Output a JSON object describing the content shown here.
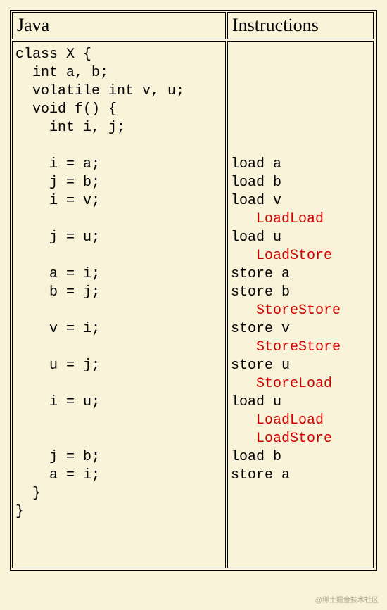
{
  "headers": {
    "left": "Java",
    "right": "Instructions"
  },
  "java_lines": [
    "class X {",
    "  int a, b;",
    "  volatile int v, u;",
    "  void f() {",
    "    int i, j;",
    "",
    "    i = a;",
    "    j = b;",
    "    i = v;",
    "",
    "    j = u;",
    "",
    "    a = i;",
    "    b = j;",
    "",
    "    v = i;",
    "",
    "    u = j;",
    "",
    "    i = u;",
    "",
    "",
    "    j = b;",
    "    a = i;",
    "  }",
    "}"
  ],
  "instr_lines": [
    {
      "text": ""
    },
    {
      "text": ""
    },
    {
      "text": ""
    },
    {
      "text": ""
    },
    {
      "text": ""
    },
    {
      "text": ""
    },
    {
      "text": "load a"
    },
    {
      "text": "load b"
    },
    {
      "text": "load v"
    },
    {
      "text": "   LoadLoad",
      "barrier": true
    },
    {
      "text": "load u"
    },
    {
      "text": "   LoadStore",
      "barrier": true
    },
    {
      "text": "store a"
    },
    {
      "text": "store b"
    },
    {
      "text": "   StoreStore",
      "barrier": true
    },
    {
      "text": "store v"
    },
    {
      "text": "   StoreStore",
      "barrier": true
    },
    {
      "text": "store u"
    },
    {
      "text": "   StoreLoad",
      "barrier": true
    },
    {
      "text": "load u"
    },
    {
      "text": "   LoadLoad",
      "barrier": true
    },
    {
      "text": "   LoadStore",
      "barrier": true
    },
    {
      "text": "load b"
    },
    {
      "text": "store a"
    },
    {
      "text": ""
    },
    {
      "text": ""
    }
  ],
  "watermark": "@稀土掘金技术社区"
}
